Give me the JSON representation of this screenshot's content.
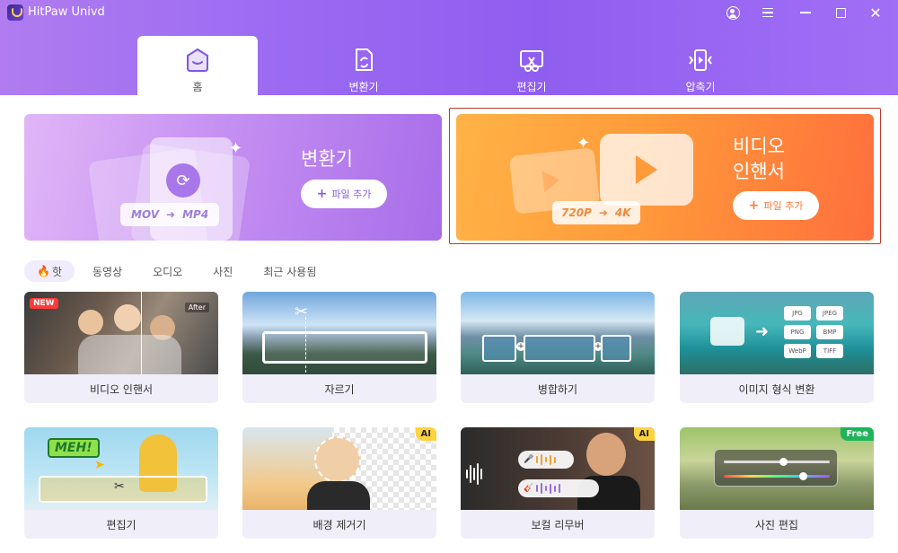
{
  "app": {
    "title": "HitPaw Univd"
  },
  "tabs": [
    {
      "label": "홈",
      "icon": "home-icon",
      "active": true
    },
    {
      "label": "변환기",
      "icon": "convert-icon"
    },
    {
      "label": "편집기",
      "icon": "edit-icon"
    },
    {
      "label": "압축기",
      "icon": "compress-icon"
    }
  ],
  "banners": {
    "convert": {
      "title": "변환기",
      "add_label": "파일 추가",
      "format_from": "MOV",
      "format_to": "MP4",
      "color": "#a86de9"
    },
    "enhancer": {
      "title_line1": "비디오",
      "title_line2": "인핸서",
      "add_label": "파일 추가",
      "res_from": "720P",
      "res_to": "4K",
      "color": "#ff7a3c"
    }
  },
  "categories": [
    {
      "label": "핫",
      "active": true
    },
    {
      "label": "동영상"
    },
    {
      "label": "오디오"
    },
    {
      "label": "사진"
    },
    {
      "label": "최근 사용됨"
    }
  ],
  "cards": [
    {
      "label": "비디오 인핸서",
      "badge": "NEW",
      "tag": "After"
    },
    {
      "label": "자르기"
    },
    {
      "label": "병합하기"
    },
    {
      "label": "이미지 형식 변환",
      "formats": [
        "JPG",
        "JPEG",
        "PNG",
        "BMP",
        "WebP",
        "TIFF"
      ]
    },
    {
      "label": "편집기",
      "sticker": "MEH!"
    },
    {
      "label": "배경 제거기",
      "badge": "AI"
    },
    {
      "label": "보컬 리무버",
      "badge": "AI"
    },
    {
      "label": "사진 편집",
      "badge": "Free"
    }
  ],
  "colors": {
    "accent": "#8f5ef0",
    "highlight_border": "#c0392b",
    "ai_badge": "#ffd23f",
    "free_badge": "#1fb45a"
  }
}
